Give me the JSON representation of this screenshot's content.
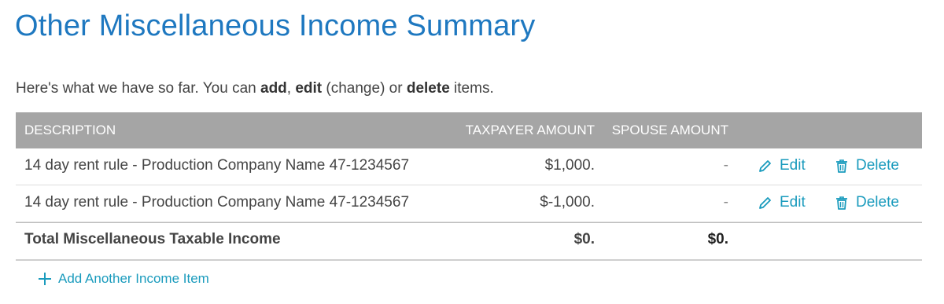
{
  "page": {
    "title": "Other Miscellaneous Income Summary"
  },
  "intro": {
    "prefix": "Here's what we have so far. You can ",
    "add": "add",
    "sep": ", ",
    "edit": "edit",
    "middle": " (change) or ",
    "delete": "delete",
    "suffix": " items."
  },
  "table": {
    "headers": {
      "description": "DESCRIPTION",
      "taxpayer": "TAXPAYER AMOUNT",
      "spouse": "SPOUSE AMOUNT"
    },
    "rows": [
      {
        "description": "14 day rent rule - Production Company Name 47-1234567",
        "taxpayer": "$1,000.",
        "spouse": "-",
        "edit": "Edit",
        "delete": "Delete"
      },
      {
        "description": "14 day rent rule - Production Company Name 47-1234567",
        "taxpayer": "$-1,000.",
        "spouse": "-",
        "edit": "Edit",
        "delete": "Delete"
      }
    ],
    "total": {
      "label": "Total Miscellaneous Taxable Income",
      "taxpayer": "$0.",
      "spouse": "$0."
    }
  },
  "actions": {
    "add_item": "Add Another Income Item"
  },
  "icons": {
    "edit": "pencil-icon",
    "delete": "trash-icon",
    "add": "plus-icon"
  },
  "colors": {
    "title": "#1e78c0",
    "link": "#1a9bbd",
    "header_bg": "#a5a5a5"
  }
}
